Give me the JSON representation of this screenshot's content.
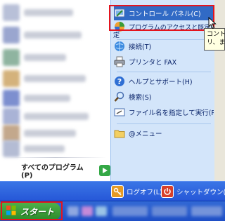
{
  "start_menu": {
    "right_items": [
      {
        "label": "コントロール パネル(C)"
      },
      {
        "label": "プログラムのアクセスと既定の設"
      },
      {
        "label": "接続(T)"
      },
      {
        "label": "プリンタと FAX"
      },
      {
        "label": "ヘルプとサポート(H)"
      },
      {
        "label": "検索(S)"
      },
      {
        "label": "ファイル名を指定して実行(R)..."
      },
      {
        "label": "@メニュー"
      }
    ],
    "access_item_continuation": "定",
    "tooltip_text": "コント\nリ、ま",
    "all_programs_label": "すべてのプログラム(P)",
    "logoff_label": "ログオフ(L)",
    "shutdown_label": "シャットダウン(U)"
  },
  "taskbar": {
    "start_label": "スタート"
  },
  "colors": {
    "highlight_box": "#e4141e",
    "selected_item": "#316ac5",
    "menu_blue": "#2657d7",
    "start_green": "#3a9c38"
  }
}
